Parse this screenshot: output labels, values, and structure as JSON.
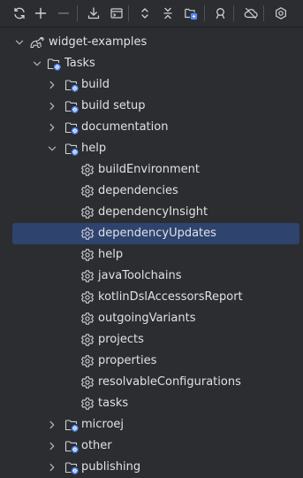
{
  "toolbar": {
    "buttons": [
      {
        "name": "reload-icon",
        "group": 0
      },
      {
        "name": "add-icon",
        "group": 0
      },
      {
        "name": "remove-icon",
        "group": 0
      },
      {
        "name": "download-sources-icon",
        "group": 1
      },
      {
        "name": "toggle-offline-icon",
        "group": 1
      },
      {
        "name": "expand-all-icon",
        "group": 2
      },
      {
        "name": "collapse-all-icon",
        "group": 2
      },
      {
        "name": "group-modules-icon",
        "group": 2
      },
      {
        "name": "analyze-dependencies-icon",
        "group": 3
      },
      {
        "name": "offline-mode-icon",
        "group": 4
      },
      {
        "name": "build-tool-settings-icon",
        "group": 5
      }
    ]
  },
  "tree": {
    "rows": [
      {
        "label": "widget-examples",
        "icon": "gradle-elephant-icon",
        "level": 0,
        "chevron": "down"
      },
      {
        "label": "Tasks",
        "icon": "task-folder-icon",
        "level": 1,
        "chevron": "down"
      },
      {
        "label": "build",
        "icon": "task-folder-icon",
        "level": 2,
        "chevron": "right"
      },
      {
        "label": "build setup",
        "icon": "task-folder-icon",
        "level": 2,
        "chevron": "right"
      },
      {
        "label": "documentation",
        "icon": "task-folder-icon",
        "level": 2,
        "chevron": "right"
      },
      {
        "label": "help",
        "icon": "task-folder-icon",
        "level": 2,
        "chevron": "down"
      },
      {
        "label": "buildEnvironment",
        "icon": "gear-icon",
        "level": 3,
        "chevron": "none"
      },
      {
        "label": "dependencies",
        "icon": "gear-icon",
        "level": 3,
        "chevron": "none"
      },
      {
        "label": "dependencyInsight",
        "icon": "gear-icon",
        "level": 3,
        "chevron": "none"
      },
      {
        "label": "dependencyUpdates",
        "icon": "gear-icon",
        "level": 3,
        "chevron": "none",
        "selected": true
      },
      {
        "label": "help",
        "icon": "gear-icon",
        "level": 3,
        "chevron": "none"
      },
      {
        "label": "javaToolchains",
        "icon": "gear-icon",
        "level": 3,
        "chevron": "none"
      },
      {
        "label": "kotlinDslAccessorsReport",
        "icon": "gear-icon",
        "level": 3,
        "chevron": "none"
      },
      {
        "label": "outgoingVariants",
        "icon": "gear-icon",
        "level": 3,
        "chevron": "none"
      },
      {
        "label": "projects",
        "icon": "gear-icon",
        "level": 3,
        "chevron": "none"
      },
      {
        "label": "properties",
        "icon": "gear-icon",
        "level": 3,
        "chevron": "none"
      },
      {
        "label": "resolvableConfigurations",
        "icon": "gear-icon",
        "level": 3,
        "chevron": "none"
      },
      {
        "label": "tasks",
        "icon": "gear-icon",
        "level": 3,
        "chevron": "none"
      },
      {
        "label": "microej",
        "icon": "task-folder-icon",
        "level": 2,
        "chevron": "right"
      },
      {
        "label": "other",
        "icon": "task-folder-icon",
        "level": 2,
        "chevron": "right"
      },
      {
        "label": "publishing",
        "icon": "task-folder-icon",
        "level": 2,
        "chevron": "right"
      }
    ]
  },
  "colors": {
    "background": "#2b2d30",
    "selection": "#2e436e",
    "text": "#dfe1e5",
    "icon": "#ced0d6",
    "accent_blue": "#548af7"
  }
}
